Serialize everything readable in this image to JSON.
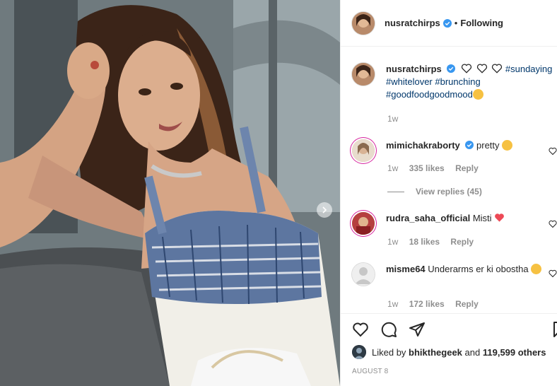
{
  "header": {
    "username": "nusratchirps",
    "separator": "•",
    "follow_status": "Following"
  },
  "caption": {
    "username": "nusratchirps",
    "hashtags": [
      "#sundaying",
      "#whitelover",
      "#brunching",
      "#goodfoodgoodmood"
    ],
    "time": "1w"
  },
  "comments": [
    {
      "username": "mimichakraborty",
      "text": "pretty",
      "time": "1w",
      "likes": "335 likes",
      "reply": "Reply",
      "verified": true
    },
    {
      "username": "rudra_saha_official",
      "text": "Misti",
      "time": "1w",
      "likes": "18 likes",
      "reply": "Reply",
      "verified": false
    },
    {
      "username": "misme64",
      "text": "Underarms er ki obostha",
      "time": "1w",
      "likes": "172 likes",
      "reply": "Reply",
      "verified": false
    }
  ],
  "view_replies": "View replies (45)",
  "likes": {
    "prefix": "Liked by",
    "user": "bhikthegeek",
    "and": "and",
    "others": "119,599 others"
  },
  "date": "AUGUST 8",
  "colors": {
    "verified": "#3897f0",
    "hashtag": "#00376b",
    "muted": "#8e8e8e",
    "heart_red": "#ed4956"
  },
  "icons": [
    "like-icon",
    "comment-icon",
    "share-icon",
    "save-icon",
    "verified-icon",
    "heart-outline-icon",
    "chevron-right-icon"
  ]
}
